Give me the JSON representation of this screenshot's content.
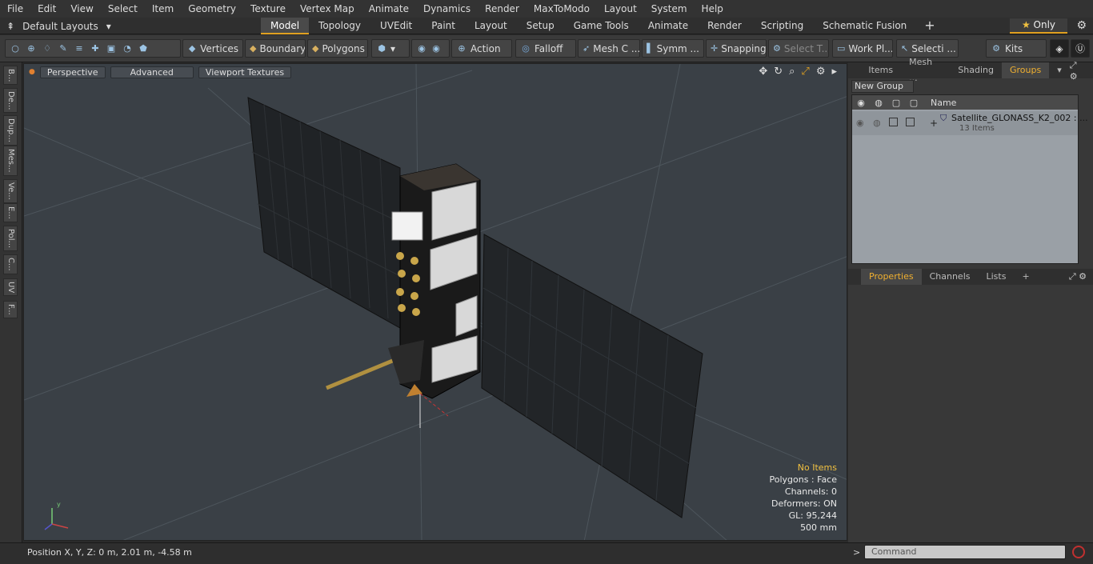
{
  "menu": [
    "File",
    "Edit",
    "View",
    "Select",
    "Item",
    "Geometry",
    "Texture",
    "Vertex Map",
    "Animate",
    "Dynamics",
    "Render",
    "MaxToModo",
    "Layout",
    "System",
    "Help"
  ],
  "layouts_label": "Default Layouts",
  "tabs": [
    {
      "label": "Model",
      "active": true
    },
    {
      "label": "Topology"
    },
    {
      "label": "UVEdit"
    },
    {
      "label": "Paint"
    },
    {
      "label": "Layout"
    },
    {
      "label": "Setup"
    },
    {
      "label": "Game Tools"
    },
    {
      "label": "Animate"
    },
    {
      "label": "Render"
    },
    {
      "label": "Scripting"
    },
    {
      "label": "Schematic Fusion"
    }
  ],
  "only_label": "Only",
  "toolbar": {
    "vertices": "Vertices",
    "boundary": "Boundary",
    "polygons": "Polygons",
    "action": "Action",
    "falloff": "Falloff",
    "mesh": "Mesh C ...",
    "symm": "Symm ...",
    "snapping": "Snapping",
    "select_t": "Select T...",
    "workpl": "Work Pl...",
    "selecti": "Selecti ...",
    "kits": "Kits"
  },
  "sidetabs": [
    "B...",
    "De...",
    "Dup...",
    "Mes...",
    "Ve...",
    "E...",
    "Pol...",
    "C...",
    "UV",
    "F..."
  ],
  "viewport": {
    "perspective": "Perspective",
    "advanced": "Advanced",
    "textures": "Viewport Textures",
    "info": {
      "items": "No Items",
      "polygons": "Polygons : Face",
      "channels": "Channels: 0",
      "deformers": "Deformers: ON",
      "gl": "GL: 95,244",
      "scale": "500 mm"
    }
  },
  "status": {
    "position": "Position X, Y, Z:   0 m, 2.01 m, -4.58 m"
  },
  "right_panel": {
    "tabs": [
      {
        "label": "Items"
      },
      {
        "label": "Mesh ..."
      },
      {
        "label": "Shading"
      },
      {
        "label": "Groups",
        "active": true
      }
    ],
    "new_group": "New Group",
    "col_name": "Name",
    "row_name": "Satellite_GLONASS_K2_002 : ...",
    "row_count": "13 Items",
    "props_tabs": [
      {
        "label": "Properties",
        "active": true
      },
      {
        "label": "Channels"
      },
      {
        "label": "Lists"
      }
    ]
  },
  "command_placeholder": "Command"
}
